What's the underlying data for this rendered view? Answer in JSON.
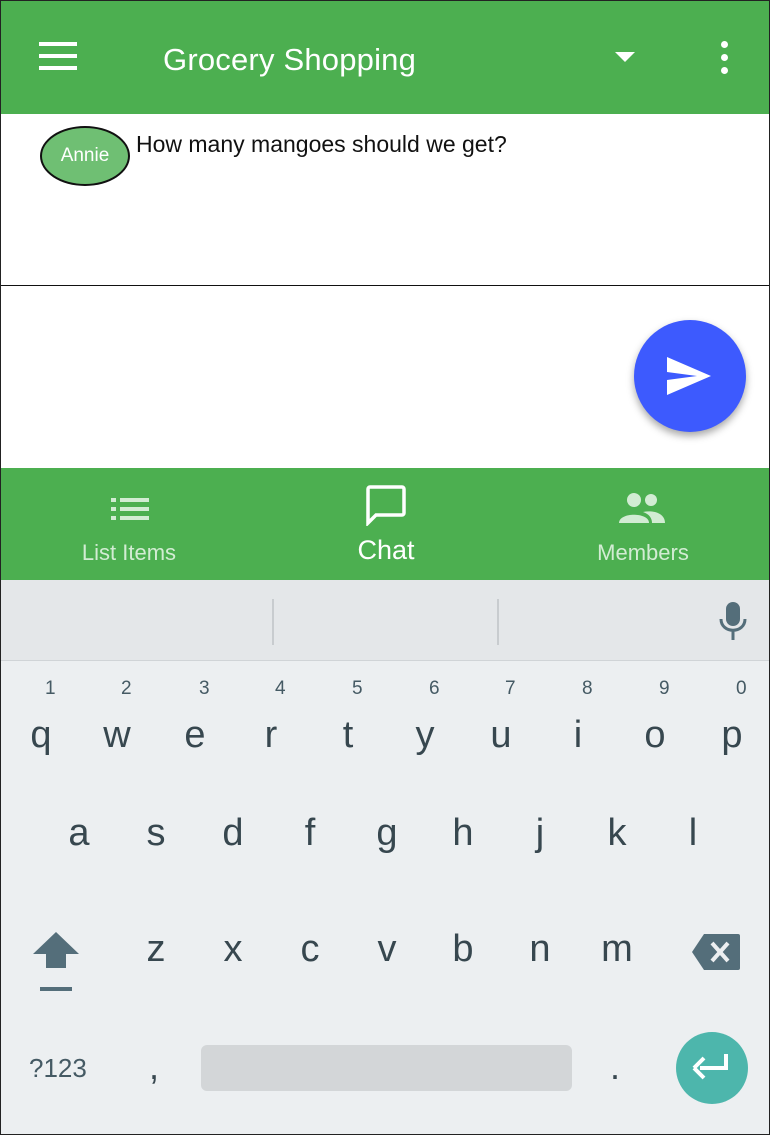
{
  "app_bar": {
    "title": "Grocery Shopping",
    "menu_icon": "hamburger-menu-icon",
    "dropdown_icon": "caret-down-icon",
    "overflow_icon": "more-vert-icon",
    "color": "#4caf50"
  },
  "chat": {
    "messages": [
      {
        "sender": "Annie",
        "text": "How many mangoes should we get?"
      }
    ]
  },
  "composer": {
    "value": "",
    "placeholder": "",
    "send_icon": "send-icon",
    "send_color": "#3d5afe"
  },
  "bottom_nav": {
    "items": [
      {
        "label": "List Items",
        "icon": "list-icon",
        "active": false
      },
      {
        "label": "Chat",
        "icon": "chat-bubble-icon",
        "active": true
      },
      {
        "label": "Members",
        "icon": "people-icon",
        "active": false
      }
    ]
  },
  "keyboard": {
    "row1": [
      {
        "key": "q",
        "hint": "1"
      },
      {
        "key": "w",
        "hint": "2"
      },
      {
        "key": "e",
        "hint": "3"
      },
      {
        "key": "r",
        "hint": "4"
      },
      {
        "key": "t",
        "hint": "5"
      },
      {
        "key": "y",
        "hint": "6"
      },
      {
        "key": "u",
        "hint": "7"
      },
      {
        "key": "i",
        "hint": "8"
      },
      {
        "key": "o",
        "hint": "9"
      },
      {
        "key": "p",
        "hint": "0"
      }
    ],
    "row2": [
      "a",
      "s",
      "d",
      "f",
      "g",
      "h",
      "j",
      "k",
      "l"
    ],
    "row3": [
      "z",
      "x",
      "c",
      "v",
      "b",
      "n",
      "m"
    ],
    "symbols_label": "?123",
    "comma": ",",
    "period": ".",
    "shift_icon": "shift-icon",
    "backspace_icon": "backspace-icon",
    "enter_icon": "enter-icon",
    "mic_icon": "microphone-icon",
    "enter_color": "#4db6ac"
  }
}
